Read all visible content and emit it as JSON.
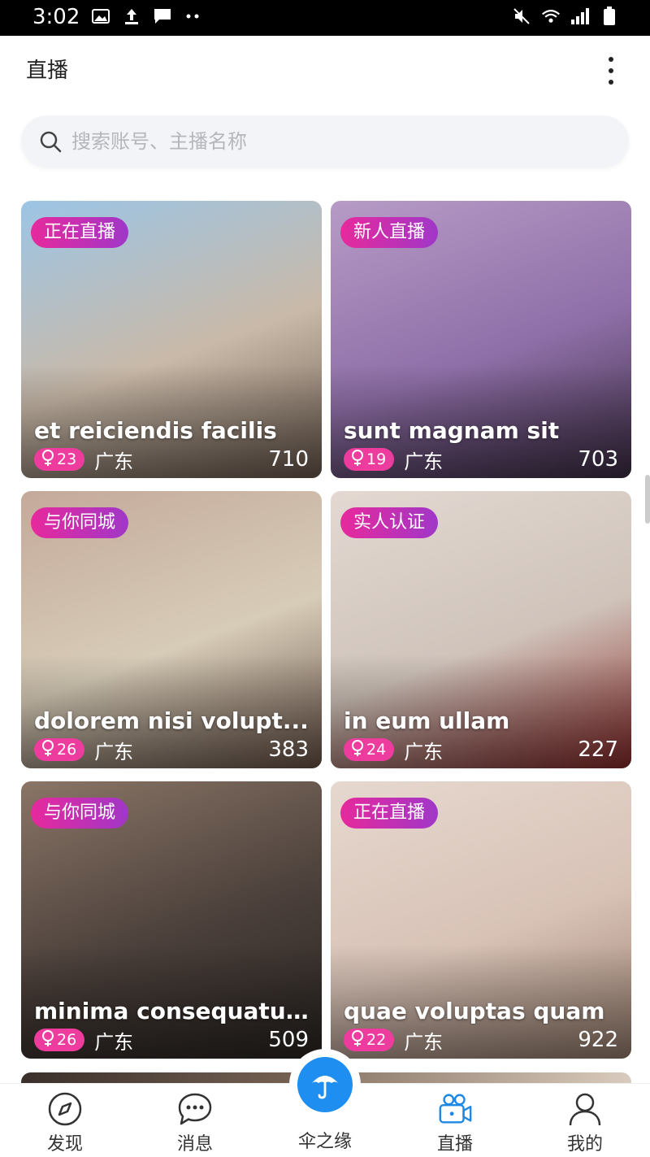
{
  "status_bar": {
    "time": "3:02",
    "left_icons": [
      "image-icon",
      "upload-icon",
      "message-icon",
      "more-dots-icon"
    ],
    "right_icons": [
      "mute-icon",
      "wifi-icon",
      "signal-icon",
      "battery-icon"
    ]
  },
  "header": {
    "title": "直播",
    "menu_icon": "more-vertical-icon"
  },
  "search": {
    "placeholder": "搜索账号、主播名称",
    "value": ""
  },
  "cards": [
    {
      "badge": "正在直播",
      "name": "et reiciendis facilis",
      "age": "23",
      "location": "广东",
      "count": "710",
      "bg": [
        "#9cc5e6",
        "#c9b9a8",
        "#6b5a4e"
      ]
    },
    {
      "badge": "新人直播",
      "name": "sunt magnam sit",
      "age": "19",
      "location": "广东",
      "count": "703",
      "bg": [
        "#b79bc6",
        "#8f6fa8",
        "#3d2d44"
      ]
    },
    {
      "badge": "与你同城",
      "name": "dolorem nisi volupt...",
      "age": "26",
      "location": "广东",
      "count": "383",
      "bg": [
        "#c4a99a",
        "#d7ccb8",
        "#6a5448"
      ]
    },
    {
      "badge": "实人认证",
      "name": "in eum ullam",
      "age": "24",
      "location": "广东",
      "count": "227",
      "bg": [
        "#e3d9d2",
        "#cfc3ba",
        "#8a2a2a"
      ]
    },
    {
      "badge": "与你同城",
      "name": "minima consequatu...",
      "age": "26",
      "location": "广东",
      "count": "509",
      "bg": [
        "#8a7566",
        "#4a3f3a",
        "#2a2522"
      ]
    },
    {
      "badge": "正在直播",
      "name": "quae voluptas quam",
      "age": "22",
      "location": "广东",
      "count": "922",
      "bg": [
        "#e6d8cf",
        "#d8c2b6",
        "#9a8070"
      ]
    }
  ],
  "tabs": [
    {
      "label": "发现",
      "icon": "compass-icon"
    },
    {
      "label": "消息",
      "icon": "chat-bubble-icon"
    },
    {
      "label": "伞之缘",
      "icon": "umbrella-icon"
    },
    {
      "label": "直播",
      "icon": "video-camera-icon"
    },
    {
      "label": "我的",
      "icon": "person-icon"
    }
  ],
  "colors": {
    "accent": "#1e88e5",
    "badge_gradient": [
      "#e7299c",
      "#a037c8"
    ],
    "age_pill": "#ee3c9e"
  }
}
